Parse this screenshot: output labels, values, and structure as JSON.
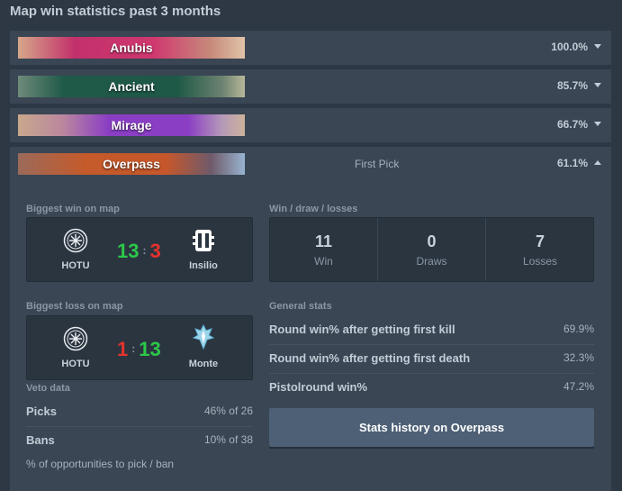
{
  "title": "Map win statistics past 3 months",
  "maps": [
    {
      "name": "Anubis",
      "pct": "100.0%",
      "color": "#c2306b"
    },
    {
      "name": "Ancient",
      "pct": "85.7%",
      "color": "#1f5a48"
    },
    {
      "name": "Mirage",
      "pct": "66.7%",
      "color": "#8a3ec4"
    },
    {
      "name": "Overpass",
      "pct": "61.1%",
      "color": "#c55a2a",
      "first_pick": "First Pick"
    }
  ],
  "details": {
    "biggest_win": {
      "label": "Biggest win on map",
      "team1": "HOTU",
      "team2": "Insilio",
      "score1": "13",
      "score2": "3",
      "colon": ":"
    },
    "biggest_loss": {
      "label": "Biggest loss on map",
      "team1": "HOTU",
      "team2": "Monte",
      "score1": "1",
      "score2": "13",
      "colon": ":"
    },
    "wdl": {
      "label": "Win / draw / losses",
      "win": "11",
      "win_label": "Win",
      "draws": "0",
      "draws_label": "Draws",
      "losses": "7",
      "losses_label": "Losses"
    },
    "general": {
      "label": "General stats",
      "rows": [
        {
          "label": "Round win% after getting first kill",
          "value": "69.9%"
        },
        {
          "label": "Round win% after getting first death",
          "value": "32.3%"
        },
        {
          "label": "Pistolround win%",
          "value": "47.2%"
        }
      ]
    },
    "veto": {
      "label": "Veto data",
      "picks_label": "Picks",
      "picks_value": "46% of 26",
      "bans_label": "Bans",
      "bans_value": "10% of 38",
      "footnote": "% of opportunities to pick / ban"
    },
    "stats_button": "Stats history on Overpass"
  }
}
